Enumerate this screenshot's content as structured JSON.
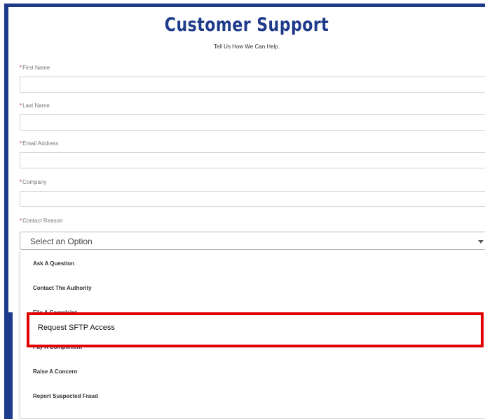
{
  "form": {
    "title": "Customer Support",
    "subtitle": "Tell Us How We Can Help.",
    "required_mark": "*",
    "fields": [
      {
        "label": "First Name",
        "value": ""
      },
      {
        "label": "Last Name",
        "value": ""
      },
      {
        "label": "Email Address",
        "value": ""
      },
      {
        "label": "Company",
        "value": ""
      }
    ],
    "contact_reason": {
      "label": "Contact Reason",
      "selected": "Select an Option",
      "options": [
        "Ask A Question",
        "Contact The Authority",
        "File A Complaint",
        "Request SFTP Access",
        "Pay A Compliment",
        "Raise A Concern",
        "Report Suspected Fraud"
      ],
      "highlighted_option": "Request SFTP Access"
    }
  },
  "colors": {
    "brand": "#1e3a8a",
    "required": "#c62828",
    "highlight_border": "#e10000"
  },
  "icons": {
    "select_caret": "chevron-down-icon"
  }
}
